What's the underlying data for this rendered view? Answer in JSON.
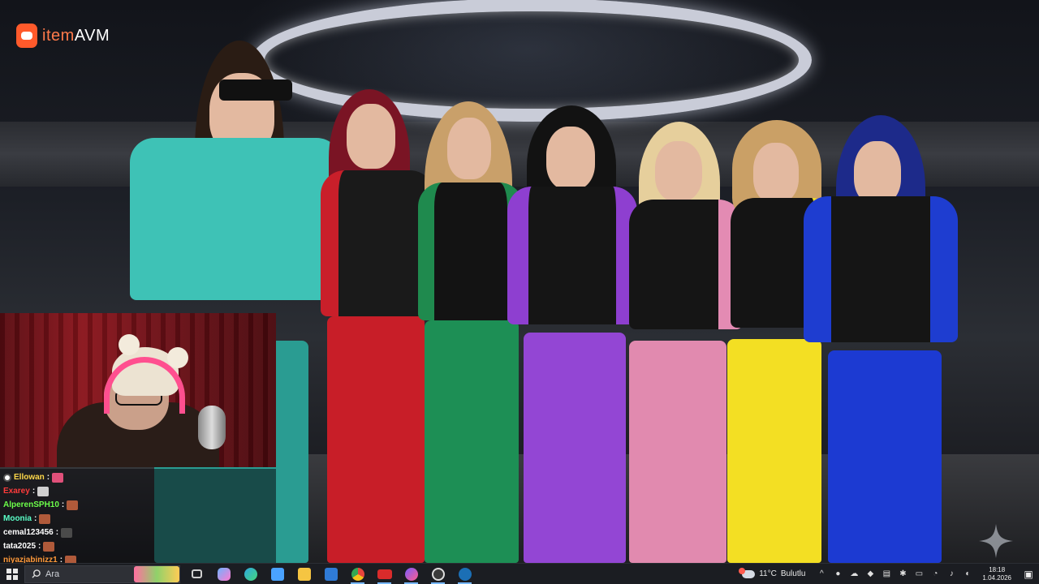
{
  "logo": {
    "text_prefix": "item",
    "text_suffix": "AVM"
  },
  "chat": {
    "messages": [
      {
        "user": "Ellowan",
        "separator": ":",
        "color": "#ffd84a",
        "emote_color": "#e0507a",
        "badge": true
      },
      {
        "user": "Exarey",
        "separator": ":",
        "color": "#ff3b3b",
        "emote_color": "#cfcfcf",
        "badge": false
      },
      {
        "user": "AlperenSPH10",
        "separator": ":",
        "color": "#6cff4a",
        "emote_color": "#b05a3a",
        "badge": false
      },
      {
        "user": "Moonia",
        "separator": ":",
        "color": "#5affc8",
        "emote_color": "#b05a3a",
        "badge": false
      },
      {
        "user": "cemal123456",
        "separator": ":",
        "color": "#ffffff",
        "emote_color": "#4a4a4a",
        "badge": false
      },
      {
        "user": "tata2025",
        "separator": ":",
        "color": "#ffffff",
        "emote_color": "#b05a3a",
        "badge": false
      },
      {
        "user": "niyazjabinizz1",
        "separator": ":",
        "color": "#ff9a3a",
        "emote_color": "#b05a3a",
        "badge": false
      }
    ]
  },
  "taskbar": {
    "search_placeholder": "Ara",
    "icons": [
      {
        "name": "task-view-icon",
        "color": "#d0d0d0",
        "active": false
      },
      {
        "name": "copilot-icon",
        "color": "#6fb3ff",
        "active": false
      },
      {
        "name": "edge-icon",
        "color": "#2fa8e0",
        "active": false
      },
      {
        "name": "store-icon",
        "color": "#4aa3ff",
        "active": false
      },
      {
        "name": "file-explorer-icon",
        "color": "#f5c542",
        "active": false
      },
      {
        "name": "outlook-icon",
        "color": "#2f7bd6",
        "active": false
      },
      {
        "name": "chrome-icon",
        "color": "#e8453c",
        "active": true
      },
      {
        "name": "voice-meeter-icon",
        "color": "#d92b2b",
        "active": true
      },
      {
        "name": "messenger-icon",
        "color": "#7a5cff",
        "active": true
      },
      {
        "name": "obs-icon",
        "color": "#3a3a3a",
        "active": true
      },
      {
        "name": "steam-icon",
        "color": "#1b6fb5",
        "active": true
      }
    ],
    "weather": {
      "temperature": "11°C",
      "condition": "Bulutlu"
    },
    "clock": {
      "time": "18:18",
      "date": "1.04.2026"
    }
  }
}
